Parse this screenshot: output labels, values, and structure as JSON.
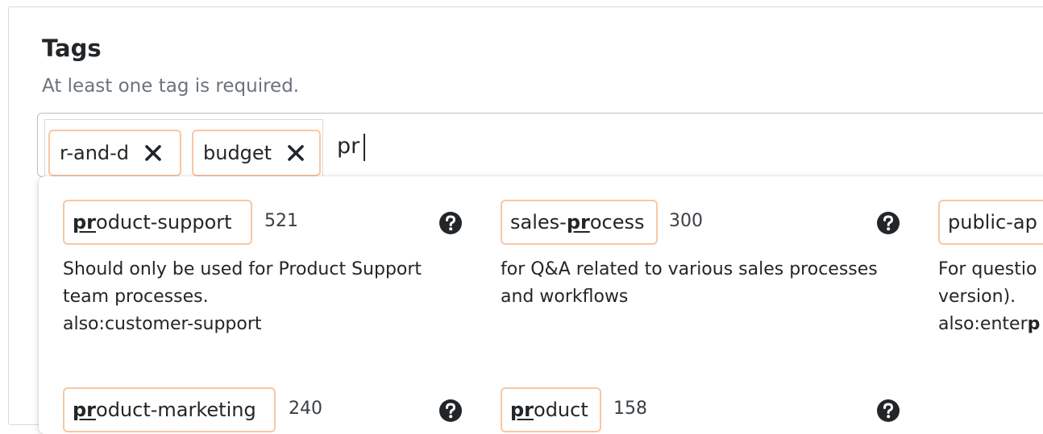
{
  "section": {
    "title": "Tags",
    "hint": "At least one tag is required."
  },
  "tag_field": {
    "chips": [
      {
        "label": "r-and-d"
      },
      {
        "label": "budget"
      }
    ],
    "input_value": "pr"
  },
  "suggestions": [
    {
      "match": "pr",
      "before": "",
      "after": "oduct-support",
      "count": "521",
      "desc_lines": [
        "Should only be used for Product Support",
        "team processes."
      ],
      "also_prefix": "also:",
      "also_match": "",
      "also_rest": "customer-support"
    },
    {
      "before": "sales-",
      "match": "pr",
      "after": "ocess",
      "count": "300",
      "desc_lines": [
        "for Q&A related to various sales processes",
        "and workflows"
      ],
      "also_prefix": "",
      "also_match": "",
      "also_rest": ""
    },
    {
      "before": "public-ap",
      "match": "",
      "after": "",
      "count": "",
      "desc_lines": [
        "For questio",
        "version)."
      ],
      "also_prefix": "also:enter",
      "also_match": "p",
      "also_rest": ""
    },
    {
      "before": "",
      "match": "pr",
      "after": "oduct-marketing",
      "count": "240",
      "desc_lines": [],
      "also_prefix": "",
      "also_match": "",
      "also_rest": ""
    },
    {
      "before": "",
      "match": "pr",
      "after": "oduct",
      "count": "158",
      "desc_lines": [],
      "also_prefix": "",
      "also_match": "",
      "also_rest": ""
    }
  ],
  "icons": {
    "remove": "close-icon",
    "help": "help-icon"
  },
  "colors": {
    "chip_border": "#f8c7a3",
    "text": "#232629",
    "hint": "#6a737c"
  }
}
